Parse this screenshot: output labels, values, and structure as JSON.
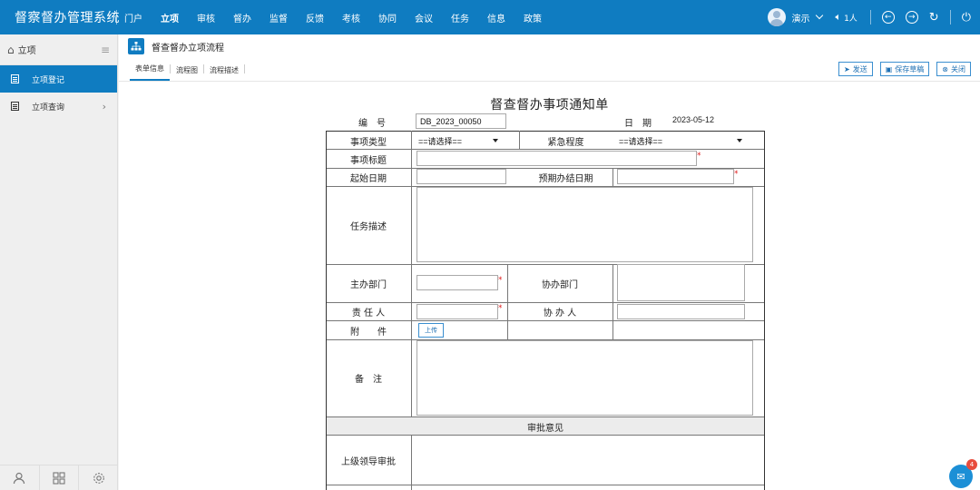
{
  "app": {
    "title": "督察督办管理系统"
  },
  "nav": [
    "门户",
    "立项",
    "审核",
    "督办",
    "监督",
    "反馈",
    "考核",
    "协同",
    "会议",
    "任务",
    "信息",
    "政策"
  ],
  "user": {
    "name": "演示",
    "online": "1人"
  },
  "sidebar": {
    "header": "立项",
    "items": [
      {
        "label": "立项登记",
        "active": true
      },
      {
        "label": "立项查询",
        "active": false
      }
    ]
  },
  "main": {
    "title": "督查督办立项流程",
    "tabs": [
      "表单信息",
      "流程图",
      "流程描述"
    ],
    "actions": {
      "send": "发送",
      "save": "保存草稿",
      "close": "关闭"
    }
  },
  "form": {
    "title": "督查督办事项通知单",
    "number_label": "编　号",
    "number_value": "DB_2023_00050",
    "date_label": "日　期",
    "date_value": "2023-05-12",
    "type_label": "事项类型",
    "type_value": "==请选择==",
    "urgency_label": "紧急程度",
    "urgency_value": "==请选择==",
    "subject_label": "事项标题",
    "start_label": "起始日期",
    "due_label": "预期办结日期",
    "desc_label": "任务描述",
    "host_dept_label": "主办部门",
    "co_dept_label": "协办部门",
    "owner_label": "责 任 人",
    "co_person_label": "协 办 人",
    "attach_label": "附　　件",
    "upload_label": "上传",
    "remark_label": "备　注",
    "approval_header": "审批意见",
    "leader_label": "上级领导审批",
    "required_mark": "*"
  },
  "notifications": {
    "count": "4"
  }
}
